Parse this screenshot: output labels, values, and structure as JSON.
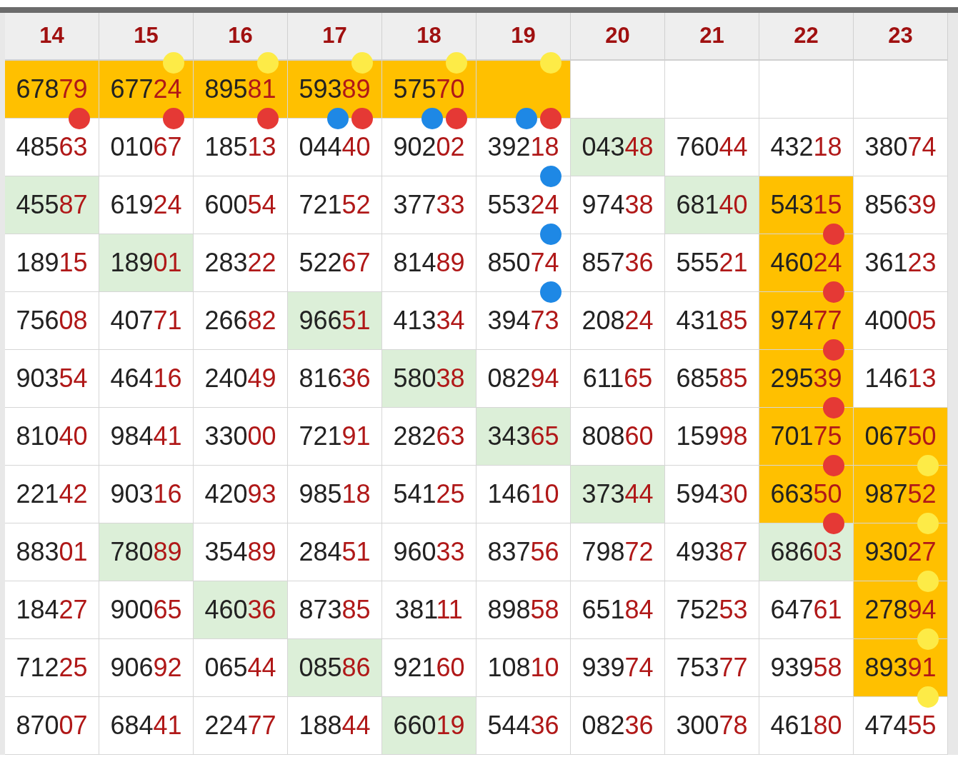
{
  "columns": [
    "14",
    "15",
    "16",
    "17",
    "18",
    "19",
    "20",
    "21",
    "22",
    "23"
  ],
  "rows": [
    {
      "cells": [
        {
          "number": "67879",
          "kind": "orange",
          "dots": [
            {
              "color": "#e53935",
              "kind": "bottom"
            }
          ]
        },
        {
          "number": "67724",
          "kind": "orange",
          "dots": [
            {
              "color": "#fdeb47",
              "kind": "top"
            },
            {
              "color": "#e53935",
              "kind": "bottom"
            }
          ]
        },
        {
          "number": "89581",
          "kind": "orange",
          "dots": [
            {
              "color": "#fdeb47",
              "kind": "top"
            },
            {
              "color": "#e53935",
              "kind": "bottom"
            }
          ]
        },
        {
          "number": "59389",
          "kind": "orange",
          "dots": [
            {
              "color": "#fdeb47",
              "kind": "top"
            },
            {
              "color": "#1e88e5",
              "kind": "bottom"
            },
            {
              "color": "#e53935",
              "kind": "bottom"
            }
          ]
        },
        {
          "number": "57570",
          "kind": "orange",
          "dots": [
            {
              "color": "#fdeb47",
              "kind": "top"
            },
            {
              "color": "#1e88e5",
              "kind": "bottom"
            },
            {
              "color": "#e53935",
              "kind": "bottom"
            }
          ]
        },
        {
          "kind": "orange",
          "dots": [
            {
              "color": "#fdeb47",
              "kind": "top"
            },
            {
              "color": "#1e88e5",
              "kind": "bottom"
            },
            {
              "color": "#e53935",
              "kind": "bottom"
            }
          ]
        },
        {
          "kind": "plain"
        },
        {
          "kind": "plain"
        },
        {
          "kind": "plain"
        },
        {
          "kind": "plain"
        }
      ]
    },
    {
      "cells": [
        {
          "number": "48563",
          "kind": "plain"
        },
        {
          "number": "01067",
          "kind": "plain"
        },
        {
          "number": "18513",
          "kind": "plain"
        },
        {
          "number": "04440",
          "kind": "plain"
        },
        {
          "number": "90202",
          "kind": "plain"
        },
        {
          "number": "39218",
          "kind": "plain",
          "dots": [
            {
              "color": "#1e88e5",
              "kind": "bottom"
            }
          ]
        },
        {
          "number": "04348",
          "kind": "green"
        },
        {
          "number": "76044",
          "kind": "plain"
        },
        {
          "number": "43218",
          "kind": "plain"
        },
        {
          "number": "38074",
          "kind": "plain"
        }
      ]
    },
    {
      "cells": [
        {
          "number": "45587",
          "kind": "green"
        },
        {
          "number": "61924",
          "kind": "plain"
        },
        {
          "number": "60054",
          "kind": "plain"
        },
        {
          "number": "72152",
          "kind": "plain"
        },
        {
          "number": "37733",
          "kind": "plain"
        },
        {
          "number": "55324",
          "kind": "plain",
          "dots": [
            {
              "color": "#1e88e5",
              "kind": "bottom"
            }
          ]
        },
        {
          "number": "97438",
          "kind": "plain"
        },
        {
          "number": "68140",
          "kind": "green"
        },
        {
          "number": "54315",
          "kind": "orange",
          "dots": [
            {
              "color": "#e53935",
              "kind": "bottom"
            }
          ]
        },
        {
          "number": "85639",
          "kind": "plain"
        }
      ]
    },
    {
      "cells": [
        {
          "number": "18915",
          "kind": "plain"
        },
        {
          "number": "18901",
          "kind": "green"
        },
        {
          "number": "28322",
          "kind": "plain"
        },
        {
          "number": "52267",
          "kind": "plain"
        },
        {
          "number": "81489",
          "kind": "plain"
        },
        {
          "number": "85074",
          "kind": "plain",
          "dots": [
            {
              "color": "#1e88e5",
              "kind": "bottom"
            }
          ]
        },
        {
          "number": "85736",
          "kind": "plain"
        },
        {
          "number": "55521",
          "kind": "plain"
        },
        {
          "number": "46024",
          "kind": "orange",
          "dots": [
            {
              "color": "#e53935",
              "kind": "bottom"
            }
          ]
        },
        {
          "number": "36123",
          "kind": "plain"
        }
      ]
    },
    {
      "cells": [
        {
          "number": "75608",
          "kind": "plain"
        },
        {
          "number": "40771",
          "kind": "plain"
        },
        {
          "number": "26682",
          "kind": "plain"
        },
        {
          "number": "96651",
          "kind": "green"
        },
        {
          "number": "41334",
          "kind": "plain"
        },
        {
          "number": "39473",
          "kind": "plain"
        },
        {
          "number": "20824",
          "kind": "plain"
        },
        {
          "number": "43185",
          "kind": "plain"
        },
        {
          "number": "97477",
          "kind": "orange",
          "dots": [
            {
              "color": "#e53935",
              "kind": "bottom"
            }
          ]
        },
        {
          "number": "40005",
          "kind": "plain"
        }
      ]
    },
    {
      "cells": [
        {
          "number": "90354",
          "kind": "plain"
        },
        {
          "number": "46416",
          "kind": "plain"
        },
        {
          "number": "24049",
          "kind": "plain"
        },
        {
          "number": "81636",
          "kind": "plain"
        },
        {
          "number": "58038",
          "kind": "green"
        },
        {
          "number": "08294",
          "kind": "plain"
        },
        {
          "number": "61165",
          "kind": "plain"
        },
        {
          "number": "68585",
          "kind": "plain"
        },
        {
          "number": "29539",
          "kind": "orange",
          "dots": [
            {
              "color": "#e53935",
              "kind": "bottom"
            }
          ]
        },
        {
          "number": "14613",
          "kind": "plain"
        }
      ]
    },
    {
      "cells": [
        {
          "number": "81040",
          "kind": "plain"
        },
        {
          "number": "98441",
          "kind": "plain"
        },
        {
          "number": "33000",
          "kind": "plain"
        },
        {
          "number": "72191",
          "kind": "plain"
        },
        {
          "number": "28263",
          "kind": "plain"
        },
        {
          "number": "34365",
          "kind": "green"
        },
        {
          "number": "80860",
          "kind": "plain"
        },
        {
          "number": "15998",
          "kind": "plain"
        },
        {
          "number": "70175",
          "kind": "orange",
          "dots": [
            {
              "color": "#e53935",
              "kind": "bottom"
            }
          ]
        },
        {
          "number": "06750",
          "kind": "orange",
          "dots": [
            {
              "color": "#fdeb47",
              "kind": "bottom"
            }
          ]
        }
      ]
    },
    {
      "cells": [
        {
          "number": "22142",
          "kind": "plain"
        },
        {
          "number": "90316",
          "kind": "plain"
        },
        {
          "number": "42093",
          "kind": "plain"
        },
        {
          "number": "98518",
          "kind": "plain"
        },
        {
          "number": "54125",
          "kind": "plain"
        },
        {
          "number": "14610",
          "kind": "plain"
        },
        {
          "number": "37344",
          "kind": "green"
        },
        {
          "number": "59430",
          "kind": "plain"
        },
        {
          "number": "66350",
          "kind": "orange",
          "dots": [
            {
              "color": "#e53935",
              "kind": "bottom"
            }
          ]
        },
        {
          "number": "98752",
          "kind": "orange",
          "dots": [
            {
              "color": "#fdeb47",
              "kind": "bottom"
            }
          ]
        }
      ]
    },
    {
      "cells": [
        {
          "number": "88301",
          "kind": "plain"
        },
        {
          "number": "78089",
          "kind": "green"
        },
        {
          "number": "35489",
          "kind": "plain"
        },
        {
          "number": "28451",
          "kind": "plain"
        },
        {
          "number": "96033",
          "kind": "plain"
        },
        {
          "number": "83756",
          "kind": "plain"
        },
        {
          "number": "79872",
          "kind": "plain"
        },
        {
          "number": "49387",
          "kind": "plain"
        },
        {
          "number": "68603",
          "kind": "green"
        },
        {
          "number": "93027",
          "kind": "orange",
          "dots": [
            {
              "color": "#fdeb47",
              "kind": "bottom"
            }
          ]
        }
      ]
    },
    {
      "cells": [
        {
          "number": "18427",
          "kind": "plain"
        },
        {
          "number": "90065",
          "kind": "plain"
        },
        {
          "number": "46036",
          "kind": "green"
        },
        {
          "number": "87385",
          "kind": "plain"
        },
        {
          "number": "38111",
          "kind": "plain"
        },
        {
          "number": "89858",
          "kind": "plain"
        },
        {
          "number": "65184",
          "kind": "plain"
        },
        {
          "number": "75253",
          "kind": "plain"
        },
        {
          "number": "64761",
          "kind": "plain"
        },
        {
          "number": "27894",
          "kind": "orange",
          "dots": [
            {
              "color": "#fdeb47",
              "kind": "bottom"
            }
          ]
        }
      ]
    },
    {
      "cells": [
        {
          "number": "71225",
          "kind": "plain"
        },
        {
          "number": "90692",
          "kind": "plain"
        },
        {
          "number": "06544",
          "kind": "plain"
        },
        {
          "number": "08586",
          "kind": "green"
        },
        {
          "number": "92160",
          "kind": "plain"
        },
        {
          "number": "10810",
          "kind": "plain"
        },
        {
          "number": "93974",
          "kind": "plain"
        },
        {
          "number": "75377",
          "kind": "plain"
        },
        {
          "number": "93958",
          "kind": "plain"
        },
        {
          "number": "89391",
          "kind": "orange",
          "dots": [
            {
              "color": "#fdeb47",
              "kind": "bottom"
            }
          ]
        }
      ]
    },
    {
      "cells": [
        {
          "number": "87007",
          "kind": "plain"
        },
        {
          "number": "68441",
          "kind": "plain"
        },
        {
          "number": "22477",
          "kind": "plain"
        },
        {
          "number": "18844",
          "kind": "plain"
        },
        {
          "number": "66019",
          "kind": "green"
        },
        {
          "number": "54436",
          "kind": "plain"
        },
        {
          "number": "08236",
          "kind": "plain"
        },
        {
          "number": "30078",
          "kind": "plain"
        },
        {
          "number": "46180",
          "kind": "plain"
        },
        {
          "number": "47455",
          "kind": "plain"
        }
      ]
    }
  ]
}
